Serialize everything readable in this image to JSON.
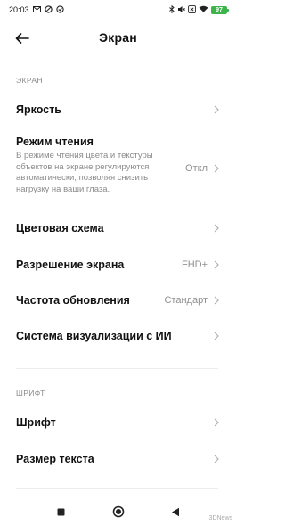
{
  "status_bar": {
    "time": "20:03",
    "battery": "97"
  },
  "header": {
    "title": "Экран"
  },
  "sections": {
    "screen": {
      "header": "ЭКРАН",
      "brightness": {
        "title": "Яркость"
      },
      "reading_mode": {
        "title": "Режим чтения",
        "description": "В режиме чтения цвета и текстуры объектов на экране регулируются автоматически, позволяя снизить нагрузку на ваши глаза.",
        "value": "Откл"
      },
      "color_scheme": {
        "title": "Цветовая схема"
      },
      "resolution": {
        "title": "Разрешение экрана",
        "value": "FHD+"
      },
      "refresh_rate": {
        "title": "Частота обновления",
        "value": "Стандарт"
      },
      "ai_visual": {
        "title": "Система визуализации с ИИ"
      }
    },
    "font": {
      "header": "ШРИФТ",
      "font": {
        "title": "Шрифт"
      },
      "text_size": {
        "title": "Размер текста"
      }
    }
  },
  "watermark": "3DNews"
}
